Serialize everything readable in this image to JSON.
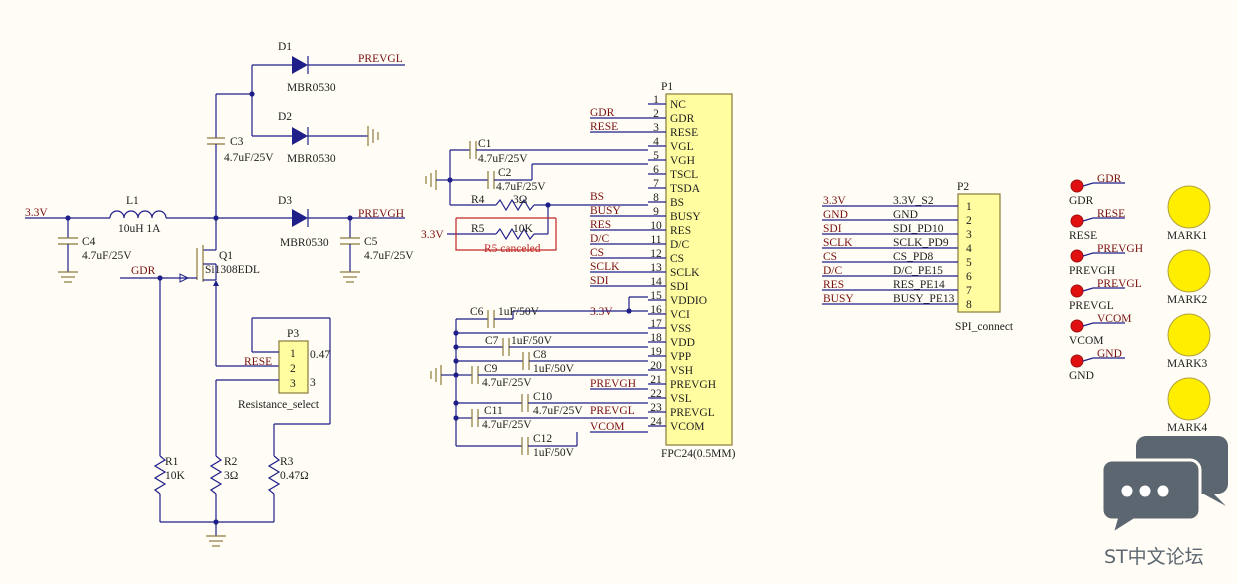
{
  "components": {
    "D1": {
      "ref": "D1",
      "part": "MBR0530"
    },
    "D2": {
      "ref": "D2",
      "part": "MBR0530"
    },
    "D3": {
      "ref": "D3",
      "part": "MBR0530"
    },
    "C3": {
      "ref": "C3",
      "val": "4.7uF/25V"
    },
    "C4": {
      "ref": "C4",
      "val": "4.7uF/25V"
    },
    "C5": {
      "ref": "C5",
      "val": "4.7uF/25V"
    },
    "L1": {
      "ref": "L1",
      "val": "10uH 1A"
    },
    "Q1": {
      "ref": "Q1",
      "part": "Si1308EDL"
    },
    "P3": {
      "ref": "P3",
      "part": "Resistance_select",
      "pins": [
        "1",
        "2",
        "3"
      ],
      "pin1_val": "0.47",
      "pin3_val": "3"
    },
    "R1": {
      "ref": "R1",
      "val": "10K"
    },
    "R2": {
      "ref": "R2",
      "val": "3Ω"
    },
    "R3": {
      "ref": "R3",
      "val": "0.47Ω"
    },
    "C1": {
      "ref": "C1",
      "val": "4.7uF/25V"
    },
    "C2": {
      "ref": "C2",
      "val": "4.7uF/25V"
    },
    "R4": {
      "ref": "R4",
      "val": "3Ω"
    },
    "R5": {
      "ref": "R5",
      "val": "10K",
      "note": "R5 canceled"
    },
    "C6": {
      "ref": "C6",
      "val": "1uF/50V"
    },
    "C7": {
      "ref": "C7",
      "val": "1uF/50V"
    },
    "C8": {
      "ref": "C8",
      "val": "1uF/50V"
    },
    "C9": {
      "ref": "C9",
      "val": "4.7uF/25V"
    },
    "C10": {
      "ref": "C10",
      "val": "4.7uF/25V"
    },
    "C11": {
      "ref": "C11",
      "val": "4.7uF/25V"
    },
    "C12": {
      "ref": "C12",
      "val": "1uF/50V"
    }
  },
  "nets": {
    "prevgl": "PREVGL",
    "prevgh": "PREVGH",
    "v33": "3.3V",
    "gdr": "GDR",
    "rese": "RESE"
  },
  "P1": {
    "ref": "P1",
    "part": "FPC24(0.5MM)",
    "pins": [
      "NC",
      "GDR",
      "RESE",
      "VGL",
      "VGH",
      "TSCL",
      "TSDA",
      "BS",
      "BUSY",
      "RES",
      "D/C",
      "CS",
      "SCLK",
      "SDI",
      "VDDIO",
      "VCI",
      "VSS",
      "VDD",
      "VPP",
      "VSH",
      "PREVGH",
      "VSL",
      "PREVGL",
      "VCOM"
    ],
    "nets": [
      "",
      "GDR",
      "RESE",
      "",
      "",
      "",
      "",
      "BS",
      "BUSY",
      "RES",
      "D/C",
      "CS",
      "SCLK",
      "SDI",
      "",
      "3.3V",
      "",
      "",
      "",
      "",
      "PREVGH",
      "",
      "PREVGL",
      "VCOM"
    ]
  },
  "P2": {
    "ref": "P2",
    "part": "SPI_connect",
    "nets": [
      "3.3V",
      "GND",
      "SDI",
      "SCLK",
      "CS",
      "D/C",
      "RES",
      "BUSY"
    ],
    "signals": [
      "3.3V_S2",
      "GND",
      "SDI_PD10",
      "SCLK_PD9",
      "CS_PD8",
      "D/C_PE15",
      "RES_PE14",
      "BUSY_PE13"
    ]
  },
  "testpoints": [
    {
      "net": "GDR",
      "label": "GDR"
    },
    {
      "net": "RESE",
      "label": "RESE"
    },
    {
      "net": "PREVGH",
      "label": "PREVGH"
    },
    {
      "net": "PREVGL",
      "label": "PREVGL"
    },
    {
      "net": "VCOM",
      "label": "VCOM"
    },
    {
      "net": "GND",
      "label": "GND"
    }
  ],
  "marks": [
    "MARK1",
    "MARK2",
    "MARK3",
    "MARK4"
  ],
  "colors": {
    "wire": "#1f1f8a",
    "net_label": "#7a1010",
    "part_body": "#fffda0",
    "testpoint": "#e01010",
    "mark": "#ffee00",
    "logo": "#5c6670"
  },
  "logo": {
    "icon": "chat-bubbles-icon",
    "text": "ST中文论坛"
  }
}
